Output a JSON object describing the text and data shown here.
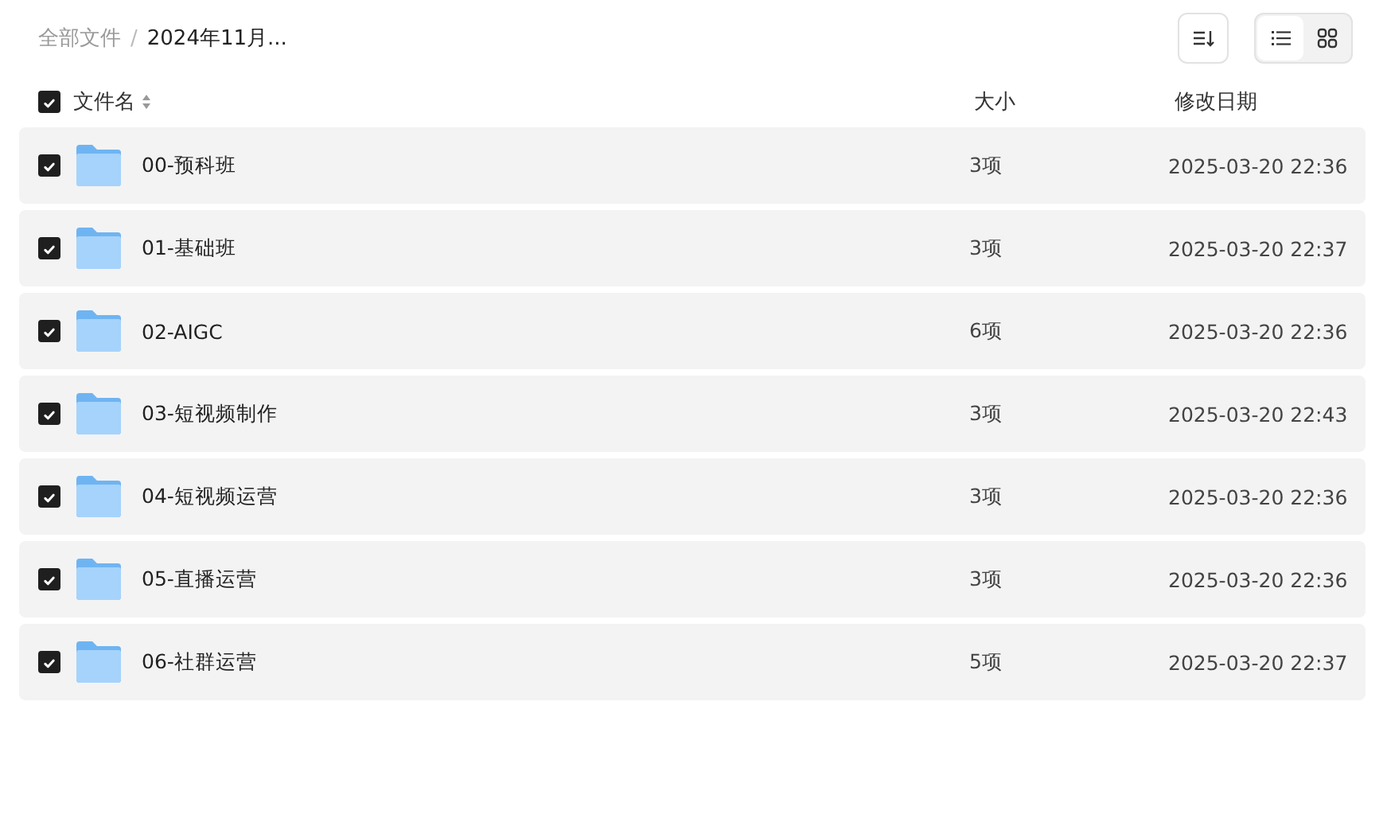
{
  "breadcrumb": [
    {
      "label": "全部文件",
      "current": false
    },
    {
      "label": "2024年11月...",
      "current": true
    }
  ],
  "breadcrumb_separator": "/",
  "view_modes": [
    {
      "kind": "list",
      "selected": true
    },
    {
      "kind": "grid",
      "selected": false
    }
  ],
  "columns": {
    "select_all_checked": true,
    "name": "文件名",
    "size": "大小",
    "modified": "修改日期"
  },
  "rows": [
    {
      "name": "00-预科班",
      "size": "3项",
      "modified": "2025-03-20 22:36",
      "checked": true
    },
    {
      "name": "01-基础班",
      "size": "3项",
      "modified": "2025-03-20 22:37",
      "checked": true
    },
    {
      "name": "02-AIGC",
      "size": "6项",
      "modified": "2025-03-20 22:36",
      "checked": true
    },
    {
      "name": "03-短视频制作",
      "size": "3项",
      "modified": "2025-03-20 22:43",
      "checked": true
    },
    {
      "name": "04-短视频运营",
      "size": "3项",
      "modified": "2025-03-20 22:36",
      "checked": true
    },
    {
      "name": "05-直播运营",
      "size": "3项",
      "modified": "2025-03-20 22:36",
      "checked": true
    },
    {
      "name": "06-社群运营",
      "size": "5项",
      "modified": "2025-03-20 22:37",
      "checked": true
    }
  ]
}
